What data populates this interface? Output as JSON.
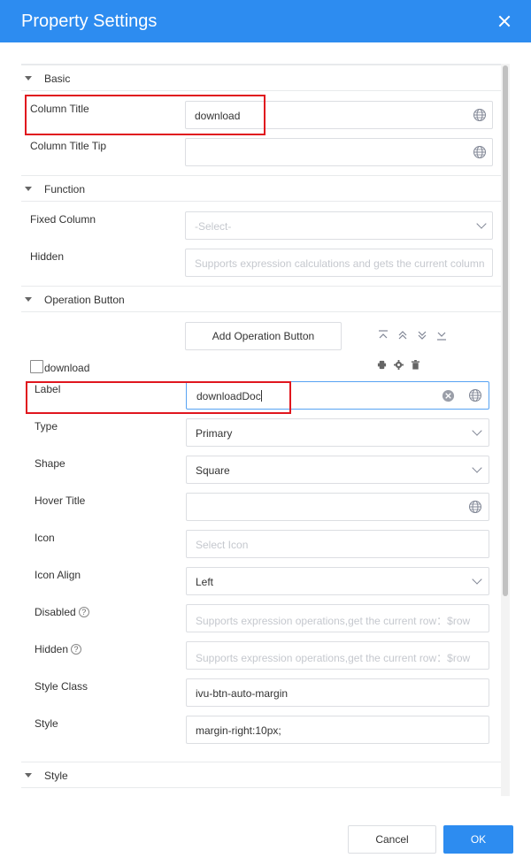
{
  "dialog": {
    "title": "Property Settings"
  },
  "sections": {
    "basic": "Basic",
    "function": "Function",
    "operation": "Operation Button",
    "style": "Style"
  },
  "basic": {
    "column_title_label": "Column Title",
    "column_title_value": "download",
    "column_title_tip_label": "Column Title Tip",
    "column_title_tip_value": ""
  },
  "function": {
    "fixed_column_label": "Fixed Column",
    "fixed_column_placeholder": "-Select-",
    "hidden_label": "Hidden",
    "hidden_placeholder": "Supports expression calculations and gets the current column"
  },
  "operation": {
    "add_button_label": "Add Operation Button",
    "item_name": "download",
    "label_label": "Label",
    "label_value": "downloadDoc",
    "type_label": "Type",
    "type_value": "Primary",
    "shape_label": "Shape",
    "shape_value": "Square",
    "hover_title_label": "Hover Title",
    "hover_title_value": "",
    "icon_label": "Icon",
    "icon_placeholder": "Select Icon",
    "icon_align_label": "Icon Align",
    "icon_align_value": "Left",
    "disabled_label": "Disabled",
    "disabled_placeholder": "Supports expression operations,get the current row：$row",
    "hidden_label": "Hidden",
    "hidden_placeholder": "Supports expression operations,get the current row：$row",
    "style_class_label": "Style Class",
    "style_class_value": "ivu-btn-auto-margin",
    "style_label": "Style",
    "style_value": "margin-right:10px;",
    "help_glyph": "?"
  },
  "footer": {
    "cancel": "Cancel",
    "ok": "OK"
  },
  "colors": {
    "accent": "#2d8cf0",
    "highlight": "#e0161e"
  }
}
